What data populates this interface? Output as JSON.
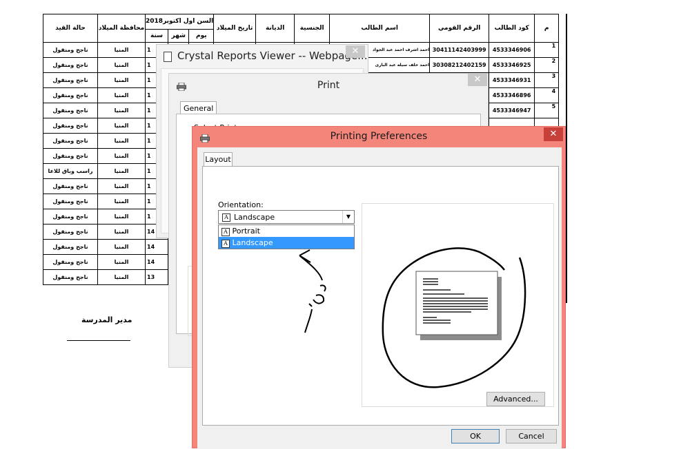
{
  "report": {
    "headers": {
      "status": "حالة القيد",
      "birth_gov": "محافظة الميلاد",
      "age_title": "السن اول اكتوبر2018",
      "day": "يوم",
      "month": "شهر",
      "year": "سنة",
      "birth_date": "تاريخ الميلاد",
      "religion": "الديانة",
      "nationality": "الجنسية",
      "student_name": "اسم الطالب",
      "national_id": "الرقم القومي",
      "student_code": "كود الطالب",
      "serial": "م"
    },
    "rows": [
      {
        "status": "ناجح ومنقول",
        "gov": "المنيا",
        "year": "1",
        "name": "احمد اشرف احمد عبد الجواد",
        "nid": "30411142403999",
        "code": "4533346906",
        "serial": "1"
      },
      {
        "status": "ناجح ومنقول",
        "gov": "المنيا",
        "year": "1",
        "name": "احمد خلف سيله عبد البارى",
        "nid": "30308212402159",
        "code": "4533346925",
        "serial": "2"
      },
      {
        "status": "ناجح ومنقول",
        "gov": "المنيا",
        "year": "1",
        "name": "",
        "nid": "",
        "code": "4533346931",
        "serial": "3"
      },
      {
        "status": "ناجح ومنقول",
        "gov": "المنيا",
        "year": "1",
        "name": "",
        "nid": "",
        "code": "4533346896",
        "serial": "4"
      },
      {
        "status": "ناجح ومنقول",
        "gov": "المنيا",
        "year": "1",
        "name": "",
        "nid": "",
        "code": "4533346947",
        "serial": "5"
      },
      {
        "status": "ناجح ومنقول",
        "gov": "المنيا",
        "year": "1",
        "name": "",
        "nid": "",
        "code": "",
        "serial": ""
      },
      {
        "status": "ناجح ومنقول",
        "gov": "المنيا",
        "year": "1",
        "name": "",
        "nid": "",
        "code": "",
        "serial": ""
      },
      {
        "status": "ناجح ومنقول",
        "gov": "المنيا",
        "year": "1",
        "name": "",
        "nid": "",
        "code": "",
        "serial": ""
      },
      {
        "status": "راسب وباق للاعا",
        "gov": "المنيا",
        "year": "1",
        "name": "",
        "nid": "",
        "code": "",
        "serial": ""
      },
      {
        "status": "ناجح ومنقول",
        "gov": "المنيا",
        "year": "1",
        "name": "",
        "nid": "",
        "code": "",
        "serial": ""
      },
      {
        "status": "ناجح ومنقول",
        "gov": "المنيا",
        "year": "1",
        "name": "",
        "nid": "",
        "code": "",
        "serial": ""
      },
      {
        "status": "ناجح ومنقول",
        "gov": "المنيا",
        "year": "1",
        "name": "",
        "nid": "",
        "code": "",
        "serial": ""
      },
      {
        "status": "ناجح ومنقول",
        "gov": "المنيا",
        "year": "14",
        "name": "",
        "nid": "",
        "code": "",
        "serial": ""
      },
      {
        "status": "ناجح ومنقول",
        "gov": "المنيا",
        "year": "14",
        "name": "",
        "nid": "",
        "code": "",
        "serial": ""
      },
      {
        "status": "ناجح ومنقول",
        "gov": "المنيا",
        "year": "14",
        "name": "",
        "nid": "",
        "code": "",
        "serial": ""
      },
      {
        "status": "ناجح ومنقول",
        "gov": "المنيا",
        "year": "13",
        "name": "",
        "nid": "",
        "code": "",
        "serial": ""
      }
    ],
    "principal": "مدير المدرسة"
  },
  "crystal_window": {
    "title": "Crystal Reports Viewer -- Webpage...",
    "close": "✕",
    "icon": "document-icon"
  },
  "print_dialog": {
    "title": "Print",
    "close": "✕",
    "tab_general": "General",
    "select_printer_partial": "Select Print",
    "icon": "printer-icon"
  },
  "prefs_dialog": {
    "title": "Printing Preferences",
    "close": "✕",
    "tab_layout": "Layout",
    "orientation_label": "Orientation:",
    "orientation_value": "Landscape",
    "options": [
      "Portrait",
      "Landscape"
    ],
    "selected_option": "Landscape",
    "advanced_button": "Advanced...",
    "ok_button": "OK",
    "cancel_button": "Cancel",
    "icon": "printer-icon",
    "titlebar_color": "#f3857a"
  }
}
